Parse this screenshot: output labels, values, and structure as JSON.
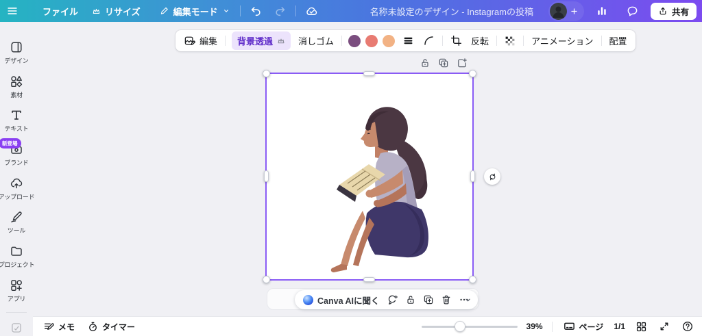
{
  "topbar": {
    "file": "ファイル",
    "resize": "リサイズ",
    "edit_mode": "編集モード",
    "title": "名称未設定のデザイン - Instagramの投稿",
    "share": "共有"
  },
  "toolbar": {
    "edit": "編集",
    "bg_remove": "背景透過",
    "eraser": "消しゴム",
    "flip": "反転",
    "animation": "アニメーション",
    "position": "配置",
    "swatches": [
      "#7b4e7f",
      "#e87b72",
      "#f2b284"
    ],
    "selection_color": "#8a5cf5"
  },
  "sidebar": {
    "items": [
      {
        "label": "デザイン"
      },
      {
        "label": "素材"
      },
      {
        "label": "テキスト"
      },
      {
        "label": "ブランド",
        "badge": "新登場"
      },
      {
        "label": "アップロード"
      },
      {
        "label": "ツール"
      },
      {
        "label": "プロジェクト"
      },
      {
        "label": "アプリ"
      }
    ]
  },
  "canvas": {
    "description": "Illustration of a woman sitting and reading a book on a white square canvas"
  },
  "floating_toolbar": {
    "ask_ai": "Canva AIに聞く"
  },
  "bottombar": {
    "notes": "メモ",
    "timer": "タイマー",
    "zoom": "39%",
    "page": "ページ",
    "page_count": "1/1"
  }
}
